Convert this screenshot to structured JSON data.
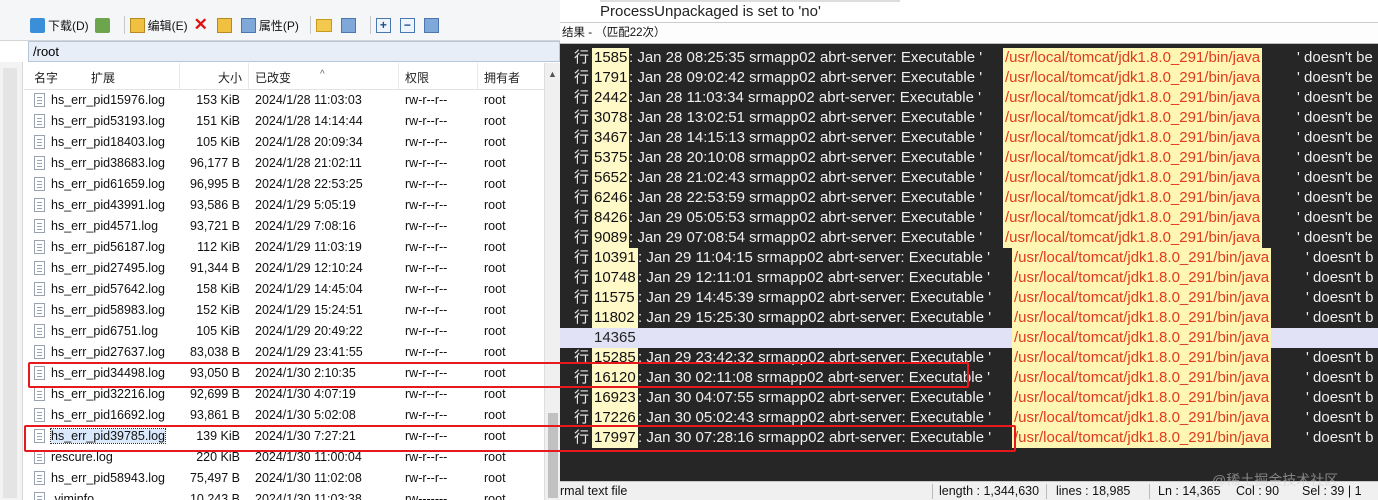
{
  "toolbar": {
    "download_label": "下载(D)",
    "edit_label": "编辑(E)",
    "properties_label": "属性(P)"
  },
  "path": "/root",
  "columns": {
    "name": "名字",
    "ext": "扩展",
    "size": "大小",
    "modified": "已改变",
    "perms": "权限",
    "owner": "拥有者"
  },
  "files": [
    {
      "name": "hs_err_pid15976.log",
      "size": "153 KiB",
      "date": "2024/1/28 11:03:03",
      "perm": "rw-r--r--",
      "owner": "root"
    },
    {
      "name": "hs_err_pid53193.log",
      "size": "151 KiB",
      "date": "2024/1/28 14:14:44",
      "perm": "rw-r--r--",
      "owner": "root"
    },
    {
      "name": "hs_err_pid18403.log",
      "size": "105 KiB",
      "date": "2024/1/28 20:09:34",
      "perm": "rw-r--r--",
      "owner": "root"
    },
    {
      "name": "hs_err_pid38683.log",
      "size": "96,177 B",
      "date": "2024/1/28 21:02:11",
      "perm": "rw-r--r--",
      "owner": "root"
    },
    {
      "name": "hs_err_pid61659.log",
      "size": "96,995 B",
      "date": "2024/1/28 22:53:25",
      "perm": "rw-r--r--",
      "owner": "root"
    },
    {
      "name": "hs_err_pid43991.log",
      "size": "93,586 B",
      "date": "2024/1/29 5:05:19",
      "perm": "rw-r--r--",
      "owner": "root"
    },
    {
      "name": "hs_err_pid4571.log",
      "size": "93,721 B",
      "date": "2024/1/29 7:08:16",
      "perm": "rw-r--r--",
      "owner": "root"
    },
    {
      "name": "hs_err_pid56187.log",
      "size": "112 KiB",
      "date": "2024/1/29 11:03:19",
      "perm": "rw-r--r--",
      "owner": "root"
    },
    {
      "name": "hs_err_pid27495.log",
      "size": "91,344 B",
      "date": "2024/1/29 12:10:24",
      "perm": "rw-r--r--",
      "owner": "root"
    },
    {
      "name": "hs_err_pid57642.log",
      "size": "158 KiB",
      "date": "2024/1/29 14:45:04",
      "perm": "rw-r--r--",
      "owner": "root"
    },
    {
      "name": "hs_err_pid58983.log",
      "size": "152 KiB",
      "date": "2024/1/29 15:24:51",
      "perm": "rw-r--r--",
      "owner": "root"
    },
    {
      "name": "hs_err_pid6751.log",
      "size": "105 KiB",
      "date": "2024/1/29 20:49:22",
      "perm": "rw-r--r--",
      "owner": "root"
    },
    {
      "name": "hs_err_pid27637.log",
      "size": "83,038 B",
      "date": "2024/1/29 23:41:55",
      "perm": "rw-r--r--",
      "owner": "root"
    },
    {
      "name": "hs_err_pid34498.log",
      "size": "93,050 B",
      "date": "2024/1/30 2:10:35",
      "perm": "rw-r--r--",
      "owner": "root"
    },
    {
      "name": "hs_err_pid32216.log",
      "size": "92,699 B",
      "date": "2024/1/30 4:07:19",
      "perm": "rw-r--r--",
      "owner": "root"
    },
    {
      "name": "hs_err_pid16692.log",
      "size": "93,861 B",
      "date": "2024/1/30 5:02:08",
      "perm": "rw-r--r--",
      "owner": "root"
    },
    {
      "name": "hs_err_pid39785.log",
      "size": "139 KiB",
      "date": "2024/1/30 7:27:21",
      "perm": "rw-r--r--",
      "owner": "root"
    },
    {
      "name": "rescure.log",
      "size": "220 KiB",
      "date": "2024/1/30 11:00:04",
      "perm": "rw-r--r--",
      "owner": "root"
    },
    {
      "name": "hs_err_pid58943.log",
      "size": "75,497 B",
      "date": "2024/1/30 11:02:08",
      "perm": "rw-r--r--",
      "owner": "root"
    },
    {
      "name": ".viminfo",
      "size": "10,243 B",
      "date": "2024/1/30 11:03:38",
      "perm": "rw-------",
      "owner": "root"
    }
  ],
  "editor": {
    "top_line": "ProcessUnpackaged is set to 'no'",
    "result_header": "结果 - （匹配22次）",
    "row_prefix": "行",
    "rows": [
      {
        "line": "1585",
        "text": ": Jan 28 08:25:35 srmapp02 abrt-server: Executable '",
        "path": "/usr/local/tomcat/jdk1.8.0_291/bin/java",
        "tail": "' doesn't be"
      },
      {
        "line": "1791",
        "text": ": Jan 28 09:02:42 srmapp02 abrt-server: Executable '",
        "path": "/usr/local/tomcat/jdk1.8.0_291/bin/java",
        "tail": "' doesn't be"
      },
      {
        "line": "2442",
        "text": ": Jan 28 11:03:34 srmapp02 abrt-server: Executable '",
        "path": "/usr/local/tomcat/jdk1.8.0_291/bin/java",
        "tail": "' doesn't be"
      },
      {
        "line": "3078",
        "text": ": Jan 28 13:02:51 srmapp02 abrt-server: Executable '",
        "path": "/usr/local/tomcat/jdk1.8.0_291/bin/java",
        "tail": "' doesn't be"
      },
      {
        "line": "3467",
        "text": ": Jan 28 14:15:13 srmapp02 abrt-server: Executable '",
        "path": "/usr/local/tomcat/jdk1.8.0_291/bin/java",
        "tail": "' doesn't be"
      },
      {
        "line": "5375",
        "text": ": Jan 28 20:10:08 srmapp02 abrt-server: Executable '",
        "path": "/usr/local/tomcat/jdk1.8.0_291/bin/java",
        "tail": "' doesn't be"
      },
      {
        "line": "5652",
        "text": ": Jan 28 21:02:43 srmapp02 abrt-server: Executable '",
        "path": "/usr/local/tomcat/jdk1.8.0_291/bin/java",
        "tail": "' doesn't be"
      },
      {
        "line": "6246",
        "text": ": Jan 28 22:53:59 srmapp02 abrt-server: Executable '",
        "path": "/usr/local/tomcat/jdk1.8.0_291/bin/java",
        "tail": "' doesn't be"
      },
      {
        "line": "8426",
        "text": ": Jan 29 05:05:53 srmapp02 abrt-server: Executable '",
        "path": "/usr/local/tomcat/jdk1.8.0_291/bin/java",
        "tail": "' doesn't be"
      },
      {
        "line": "9089",
        "text": ": Jan 29 07:08:54 srmapp02 abrt-server: Executable '",
        "path": "/usr/local/tomcat/jdk1.8.0_291/bin/java",
        "tail": "' doesn't be"
      },
      {
        "line": "10391",
        "text": ": Jan 29 11:04:15 srmapp02 abrt-server: Executable '",
        "path": "/usr/local/tomcat/jdk1.8.0_291/bin/java",
        "tail": "' doesn't b"
      },
      {
        "line": "10748",
        "text": ": Jan 29 12:11:01 srmapp02 abrt-server: Executable '",
        "path": "/usr/local/tomcat/jdk1.8.0_291/bin/java",
        "tail": "' doesn't b"
      },
      {
        "line": "11575",
        "text": ": Jan 29 14:45:39 srmapp02 abrt-server: Executable '",
        "path": "/usr/local/tomcat/jdk1.8.0_291/bin/java",
        "tail": "' doesn't b"
      },
      {
        "line": "11802",
        "text": ": Jan 29 15:25:30 srmapp02 abrt-server: Executable '",
        "path": "/usr/local/tomcat/jdk1.8.0_291/bin/java",
        "tail": "' doesn't b"
      },
      {
        "line": "14365",
        "text": "",
        "path": "/usr/local/tomcat/jdk1.8.0_291/bin/java",
        "tail": "",
        "current": true
      },
      {
        "line": "15285",
        "text": ": Jan 29 23:42:32 srmapp02 abrt-server: Executable '",
        "path": "/usr/local/tomcat/jdk1.8.0_291/bin/java",
        "tail": "' doesn't b"
      },
      {
        "line": "16120",
        "text": ": Jan 30 02:11:08 srmapp02 abrt-server: Executable '",
        "path": "/usr/local/tomcat/jdk1.8.0_291/bin/java",
        "tail": "' doesn't b"
      },
      {
        "line": "16923",
        "text": ": Jan 30 04:07:55 srmapp02 abrt-server: Executable '",
        "path": "/usr/local/tomcat/jdk1.8.0_291/bin/java",
        "tail": "' doesn't b"
      },
      {
        "line": "17226",
        "text": ": Jan 30 05:02:43 srmapp02 abrt-server: Executable '",
        "path": "/usr/local/tomcat/jdk1.8.0_291/bin/java",
        "tail": "' doesn't b"
      },
      {
        "line": "17997",
        "text": ": Jan 30 07:28:16 srmapp02 abrt-server: Executable '",
        "path": "/usr/local/tomcat/jdk1.8.0_291/bin/java",
        "tail": "' doesn't b"
      }
    ]
  },
  "status": {
    "filetype": "rmal text file",
    "length": "length : 1,344,630",
    "lines": "lines : 18,985",
    "ln": "Ln : 14,365",
    "col": "Col : 90",
    "sel": "Sel : 39 | 1"
  },
  "watermark": "@稀土掘金技术社区",
  "colors": {
    "highlight_box": "#e8191c",
    "match_path": "#e03a1e",
    "match_background": "#fff6b4",
    "editor_background": "#262626"
  }
}
